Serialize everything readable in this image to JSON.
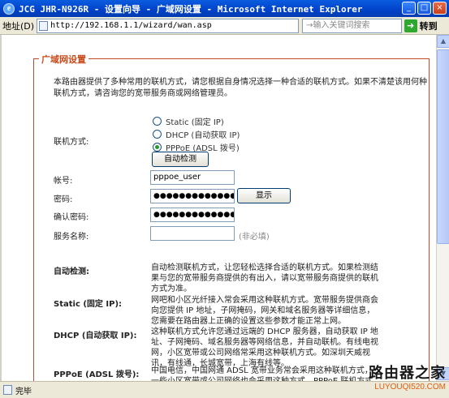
{
  "window": {
    "title": "JCG JHR-N926R - 设置向导 - 广域网设置 - Microsoft Internet Explorer",
    "controls": {
      "minimize": "_",
      "maximize": "□",
      "close": "×"
    }
  },
  "addressbar": {
    "label": "地址(D)",
    "url": "http://192.168.1.1/wizard/wan.asp",
    "search_placeholder": "→输入关键词搜索",
    "go_label": "转到"
  },
  "panel": {
    "legend": "广域网设置",
    "intro": "本路由器提供了多种常用的联机方式，请您根据自身情况选择一种合适的联机方式。如果不清楚该用何种联机方式，请咨询您的宽带服务商或网络管理员。"
  },
  "form": {
    "connection_label": "联机方式:",
    "options": [
      {
        "label": "Static (固定 IP)",
        "selected": false
      },
      {
        "label": "DHCP (自动获取 IP)",
        "selected": false
      },
      {
        "label": "PPPoE (ADSL 拨号)",
        "selected": true
      }
    ],
    "auto_detect_button": "自动检测",
    "account_label": "帐号:",
    "account_value": "pppoe_user",
    "password_label": "密码:",
    "password_value": "●●●●●●●●●●●●●",
    "show_button": "显示",
    "confirm_label": "确认密码:",
    "confirm_value": "●●●●●●●●●●●●●",
    "service_label": "服务名称:",
    "service_value": "",
    "service_hint": "(非必填)"
  },
  "descriptions": [
    {
      "head": "自动检测:",
      "text": "自动检测联机方式，让您轻松选择合适的联机方式。如果检测结果与您的宽带服务商提供的有出入，请以宽带服务商提供的联机方式为准。"
    },
    {
      "head": "Static (固定 IP):",
      "text": "网吧和小区光纤接入常会采用这种联机方式。宽带服务提供商会向您提供 IP 地址，子网掩码，网关和域名服务器等详细信息，您需要在路由器上正确的设置这些参数才能正常上网。"
    },
    {
      "head": "DHCP (自动获取 IP):",
      "text": "这种联机方式允许您通过远端的 DHCP 服务器，自动获取 IP 地址、子网掩码、域名服务器等网络信息，并自动联机。有线电视网，小区宽带或公司网络常采用这种联机方式。如深圳天威视讯，有线通，长城宽带，上海有线等。"
    },
    {
      "head": "PPPoE (ADSL 拨号):",
      "text": "中国电信，中国网通 ADSL 宽带业务常会采用这种联机方式，一些小区宽带或公司网络也会采用这种方式。PPPoE 联机方式需"
    }
  ],
  "statusbar": {
    "text": "完毕"
  },
  "watermark": {
    "big": "路由器之家",
    "small": "LUYOUQI520.COM"
  },
  "colors": {
    "legend": "#c84a1a",
    "panel_border": "#c24a2a",
    "titlebar": "#0042c8"
  }
}
